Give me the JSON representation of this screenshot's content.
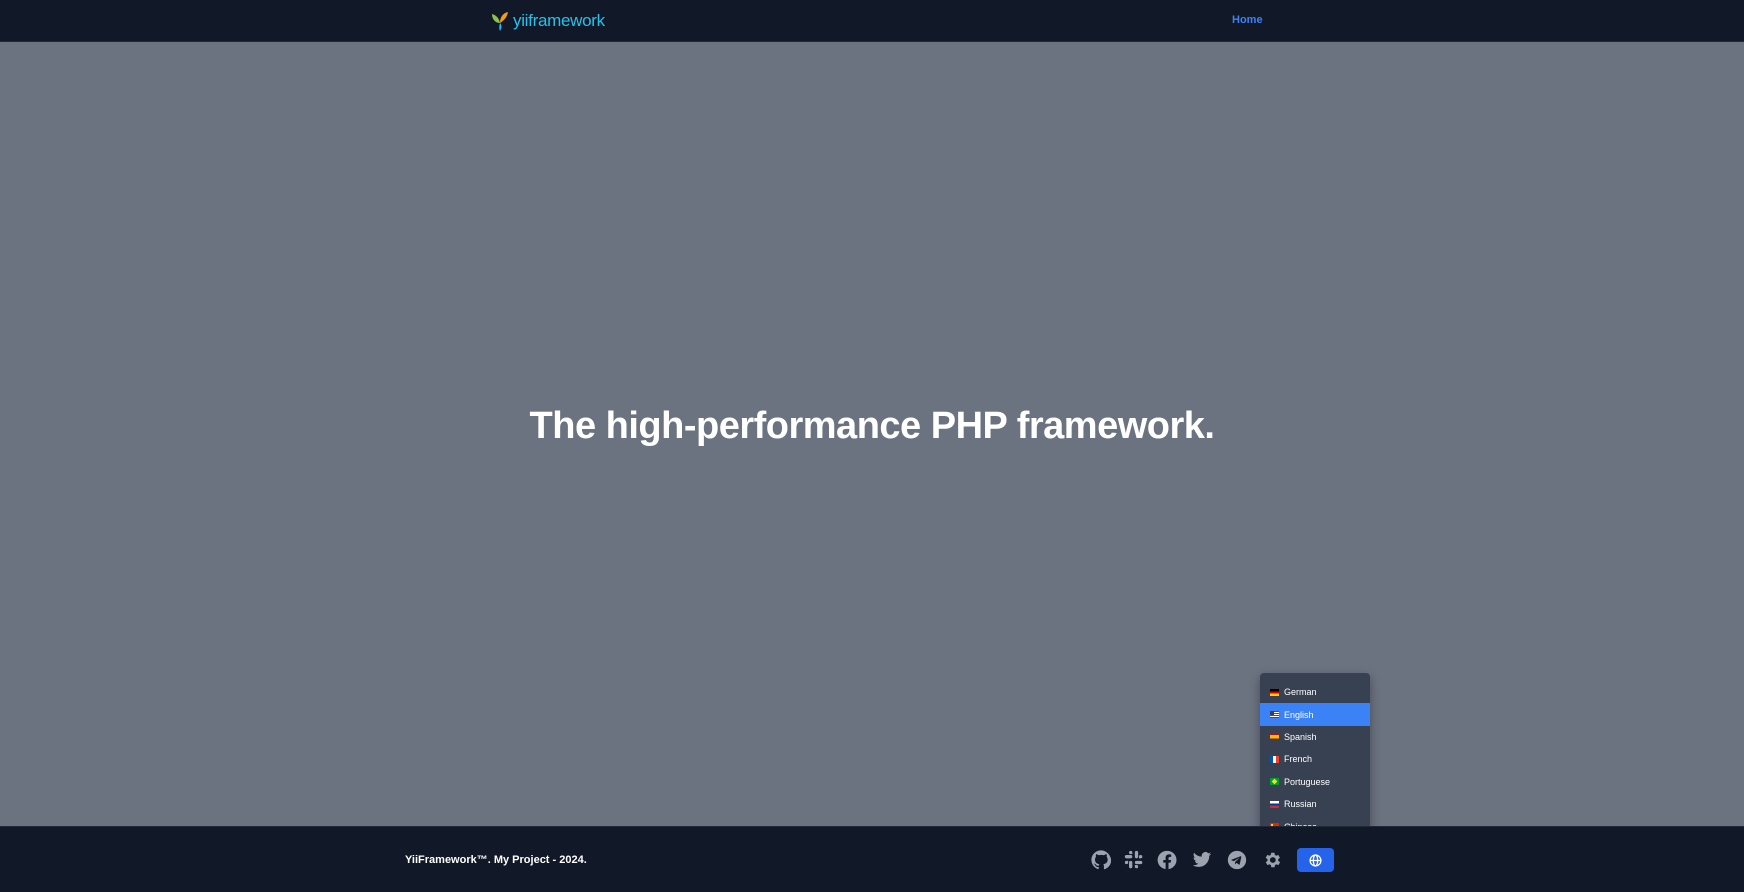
{
  "navbar": {
    "brand_text": "yiiframework",
    "home_label": "Home"
  },
  "hero": {
    "title": "The high-performance PHP framework."
  },
  "footer": {
    "copyright": "YiiFramework™. My Project - 2024.",
    "social_icons": [
      "github-icon",
      "slack-icon",
      "facebook-icon",
      "twitter-icon",
      "telegram-icon",
      "settings-icon"
    ],
    "language_button_icon": "globe-icon"
  },
  "language_menu": {
    "items": [
      {
        "label": "German",
        "flag": "de"
      },
      {
        "label": "English",
        "flag": "us"
      },
      {
        "label": "Spanish",
        "flag": "es"
      },
      {
        "label": "French",
        "flag": "fr"
      },
      {
        "label": "Portuguese",
        "flag": "br"
      },
      {
        "label": "Russian",
        "flag": "ru"
      },
      {
        "label": "Chinese",
        "flag": "cn"
      }
    ],
    "active": "English"
  },
  "colors": {
    "page_background": "#6b7280",
    "bar_background": "#111827",
    "accent": "#3b82f6",
    "button": "#2563eb",
    "menu_background": "#374151",
    "brand_text": "#22c3ee"
  }
}
